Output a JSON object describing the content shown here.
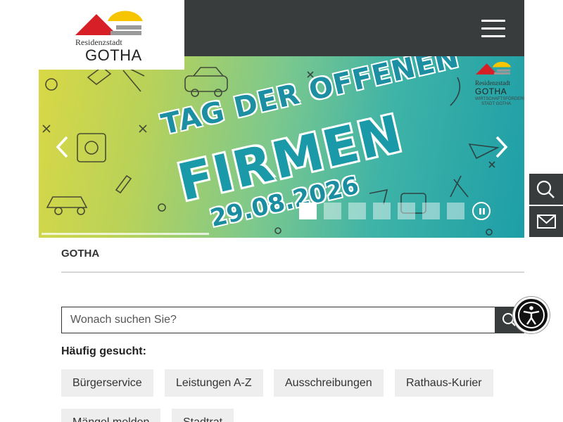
{
  "header": {
    "logo_small": "Residenzstadt",
    "logo_big": "GOTHA",
    "menu_icon": "hamburger-menu-icon"
  },
  "hero": {
    "headline_top": "TAG DER OFFENEN",
    "headline_main": "FIRMEN",
    "date": "29.08.2026",
    "corner_logo_small": "Residenzstadt",
    "corner_logo_big": "GOTHA",
    "partner_logo": "WIRTSCHAFTSFÖRDERUNG STADT GOTHA",
    "prev_icon": "chevron-left-icon",
    "next_icon": "chevron-right-icon",
    "pause_icon": "pause-icon",
    "slides_total": 7,
    "active_slide": 1
  },
  "side_actions": {
    "search_icon": "search-icon",
    "mail_icon": "mail-icon"
  },
  "breadcrumb": "GOTHA",
  "search": {
    "placeholder": "Wonach suchen Sie?",
    "value": ""
  },
  "frequent": {
    "title": "Häufig gesucht:",
    "items": [
      "Bürgerservice",
      "Leistungen A-Z",
      "Ausschreibungen",
      "Rathaus-Kurier",
      "Mängel melden",
      "Stadtrat"
    ]
  },
  "colors": {
    "dark": "#383c3c",
    "chip": "#eeeeee",
    "logo_red": "#d71f27",
    "logo_yellow": "#f6c500",
    "logo_gray": "#9a9a9a"
  }
}
